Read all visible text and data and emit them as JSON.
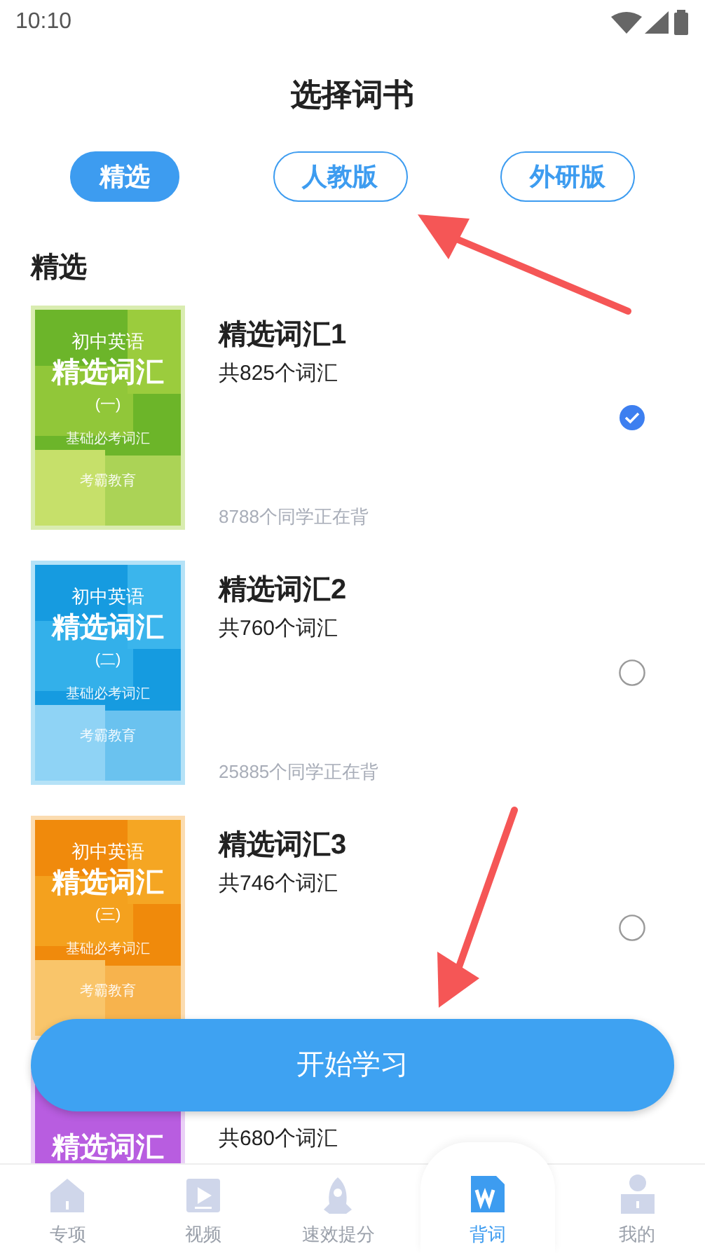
{
  "status_bar": {
    "time": "10:10"
  },
  "header": {
    "title": "选择词书"
  },
  "tabs": [
    {
      "label": "精选",
      "selected": true
    },
    {
      "label": "人教版",
      "selected": false
    },
    {
      "label": "外研版",
      "selected": false
    }
  ],
  "section": {
    "title": "精选"
  },
  "books": [
    {
      "cover": {
        "series": "初中英语",
        "title": "精选词汇",
        "volume": "(一)",
        "subtitle": "基础必考词汇",
        "publisher": "考霸教育"
      },
      "title": "精选词汇1",
      "count": "共825个词汇",
      "readers": "8788个同学正在背",
      "selected": true
    },
    {
      "cover": {
        "series": "初中英语",
        "title": "精选词汇",
        "volume": "(二)",
        "subtitle": "基础必考词汇",
        "publisher": "考霸教育"
      },
      "title": "精选词汇2",
      "count": "共760个词汇",
      "readers": "25885个同学正在背",
      "selected": false
    },
    {
      "cover": {
        "series": "初中英语",
        "title": "精选词汇",
        "volume": "(三)",
        "subtitle": "基础必考词汇",
        "publisher": "考霸教育"
      },
      "title": "精选词汇3",
      "count": "共746个词汇",
      "selected": false
    },
    {
      "cover": {
        "title": "精选词汇"
      },
      "count": "共680个词汇"
    }
  ],
  "start_button": {
    "label": "开始学习"
  },
  "nav": [
    {
      "label": "专项",
      "selected": false
    },
    {
      "label": "视频",
      "selected": false
    },
    {
      "label": "速效提分",
      "selected": false
    },
    {
      "label": "背词",
      "selected": true
    },
    {
      "label": "我的",
      "selected": false
    }
  ]
}
